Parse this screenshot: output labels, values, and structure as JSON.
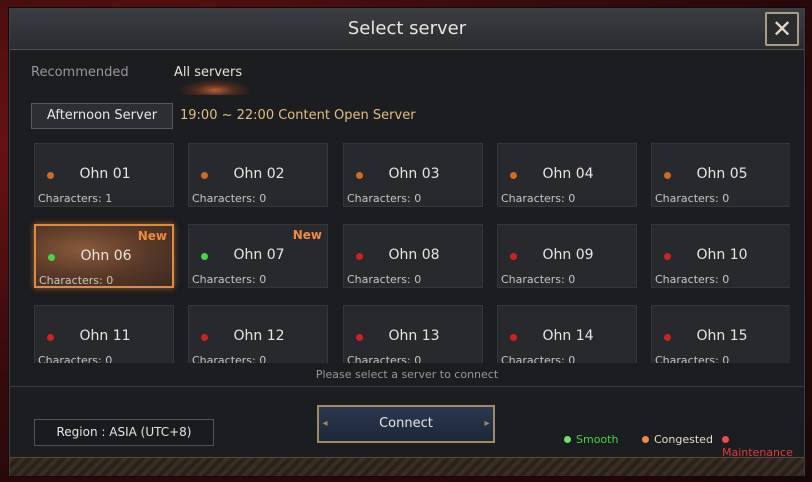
{
  "window": {
    "title": "Select server",
    "close_glyph": "✕"
  },
  "tabs": [
    {
      "label": "Recommended",
      "active": false
    },
    {
      "label": "All servers",
      "active": true
    }
  ],
  "group": {
    "button_label": "Afternoon Server",
    "description": "19:00 ~ 22:00 Content Open Server"
  },
  "status_colors": {
    "smooth": "#45d645",
    "congested": "#d46a1e",
    "maintenance": "#d02020"
  },
  "servers": [
    {
      "name": "Ohn 01",
      "characters": "Characters: 1",
      "status": "congested",
      "new": false,
      "selected": false
    },
    {
      "name": "Ohn 02",
      "characters": "Characters: 0",
      "status": "congested",
      "new": false,
      "selected": false
    },
    {
      "name": "Ohn 03",
      "characters": "Characters: 0",
      "status": "congested",
      "new": false,
      "selected": false
    },
    {
      "name": "Ohn 04",
      "characters": "Characters: 0",
      "status": "congested",
      "new": false,
      "selected": false
    },
    {
      "name": "Ohn 05",
      "characters": "Characters: 0",
      "status": "congested",
      "new": false,
      "selected": false
    },
    {
      "name": "Ohn 06",
      "characters": "Characters: 0",
      "status": "smooth",
      "new": true,
      "selected": true
    },
    {
      "name": "Ohn 07",
      "characters": "Characters: 0",
      "status": "smooth",
      "new": true,
      "selected": false
    },
    {
      "name": "Ohn 08",
      "characters": "Characters: 0",
      "status": "maintenance",
      "new": false,
      "selected": false
    },
    {
      "name": "Ohn 09",
      "characters": "Characters: 0",
      "status": "maintenance",
      "new": false,
      "selected": false
    },
    {
      "name": "Ohn 10",
      "characters": "Characters: 0",
      "status": "maintenance",
      "new": false,
      "selected": false
    },
    {
      "name": "Ohn 11",
      "characters": "Characters: 0",
      "status": "maintenance",
      "new": false,
      "selected": false
    },
    {
      "name": "Ohn 12",
      "characters": "Characters: 0",
      "status": "maintenance",
      "new": false,
      "selected": false
    },
    {
      "name": "Ohn 13",
      "characters": "Characters: 0",
      "status": "maintenance",
      "new": false,
      "selected": false
    },
    {
      "name": "Ohn 14",
      "characters": "Characters: 0",
      "status": "maintenance",
      "new": false,
      "selected": false
    },
    {
      "name": "Ohn 15",
      "characters": "Characters: 0",
      "status": "maintenance",
      "new": false,
      "selected": false
    }
  ],
  "new_badge": "New",
  "hint": "Please select a server to connect",
  "region": "Region : ASIA (UTC+8)",
  "connect_label": "Connect",
  "legend": [
    {
      "label": "Smooth",
      "color": "#45d645",
      "dot": "#6ee06e"
    },
    {
      "label": "Congested",
      "color": "#e8dcc8",
      "dot": "#f08a4a"
    },
    {
      "label": "Maintenance",
      "color": "#e03a3a",
      "dot": "#f04a4a"
    }
  ]
}
